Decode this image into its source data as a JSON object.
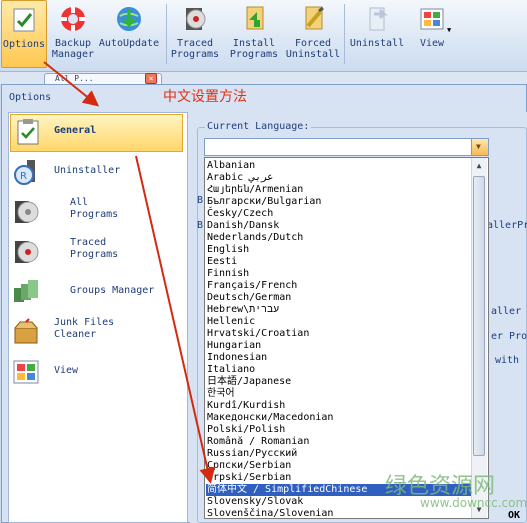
{
  "toolbar": {
    "items": [
      {
        "id": "options",
        "label": "Options",
        "icon": "options-icon"
      },
      {
        "id": "backup",
        "label": "Backup\nManager",
        "icon": "lifebuoy-icon"
      },
      {
        "id": "autoupdate",
        "label": "AutoUpdate",
        "icon": "globe-update-icon"
      },
      {
        "id": "traced",
        "label": "Traced\nPrograms",
        "icon": "traced-programs-icon"
      },
      {
        "id": "install",
        "label": "Install\nPrograms",
        "icon": "install-icon"
      },
      {
        "id": "forced",
        "label": "Forced\nUninstall",
        "icon": "forced-uninstall-icon"
      },
      {
        "id": "uninstall",
        "label": "Uninstall",
        "icon": "uninstall-icon"
      },
      {
        "id": "view",
        "label": "View",
        "icon": "view-icon"
      }
    ]
  },
  "background_tab": {
    "label": "All P..."
  },
  "dialog": {
    "title": "Options",
    "annotation": "中文设置方法",
    "nav": [
      {
        "label": "General",
        "icon": "clipboard-check-icon"
      },
      {
        "label": "Uninstaller",
        "icon": "uninstaller-icon"
      },
      {
        "label": "All\nPrograms",
        "icon": "cd-icon"
      },
      {
        "label": "Traced\nPrograms",
        "icon": "traced-cd-icon"
      },
      {
        "label": "Groups Manager",
        "icon": "groups-icon"
      },
      {
        "label": "Junk Files\nCleaner",
        "icon": "junk-cleaner-icon"
      },
      {
        "label": "View",
        "icon": "view-icon"
      }
    ],
    "current_language_label": "Current Language:",
    "languages": [
      "Albanian",
      "Arabic عربي",
      "Հայերեն/Armenian",
      "Български/Bulgarian",
      "Česky/Czech",
      "Danish/Dansk",
      "Nederlands/Dutch",
      "English",
      "Eesti",
      "Finnish",
      "Français/French",
      "Deutsch/German",
      "Hebrew\\עברית",
      "Hellenic",
      "Hrvatski/Croatian",
      "Hungarian",
      "Indonesian",
      "Italiano",
      "日本語/Japanese",
      "한국어",
      "Kurdî/Kurdish",
      "Македонски/Macedonian",
      "Polski/Polish",
      "Română / Romanian",
      "Russian/Русский",
      "Српски/Serbian",
      "Srpski/Serbian",
      "简体中文 / SimplifiedChinese",
      "Slovensky/Slovak",
      "Slovenščina/Slovenian"
    ],
    "selected_index": 27,
    "bg_fragments": [
      "allerPr",
      "aller",
      "er Pro",
      "with",
      "B",
      "B"
    ],
    "ok_label": "OK"
  },
  "watermark": {
    "line1": "绿色资源网",
    "line2": "www.downcc.com"
  },
  "colors": {
    "annotation": "#e03010",
    "selection": "#2f5fbf",
    "accent": "#ffc851"
  }
}
